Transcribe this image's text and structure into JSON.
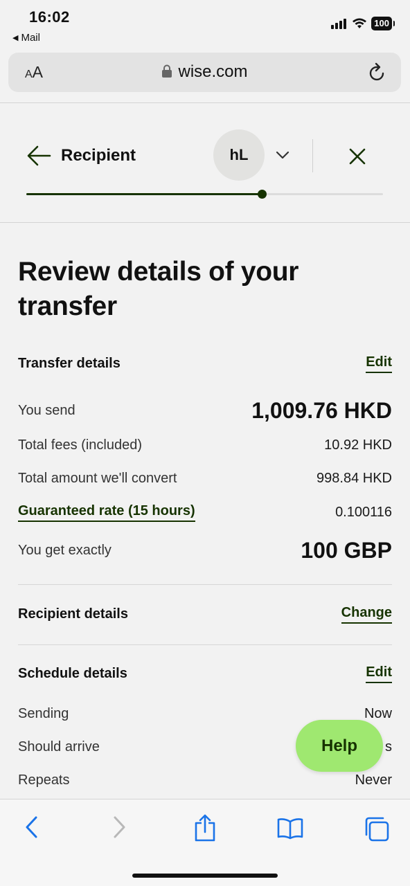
{
  "status_bar": {
    "time": "16:02",
    "back_app": "Mail",
    "battery": "100",
    "icons": [
      "signal-icon",
      "wifi-icon",
      "battery-icon"
    ]
  },
  "browser": {
    "text_size_label_small": "A",
    "text_size_label_large": "A",
    "url": "wise.com"
  },
  "header": {
    "step_title": "Recipient",
    "avatar_initials": "hL",
    "progress_fraction": 0.66
  },
  "page": {
    "title": "Review details of your transfer"
  },
  "transfer": {
    "section_label": "Transfer details",
    "edit_label": "Edit",
    "rows": [
      {
        "label": "You send",
        "value": "1,009.76 HKD"
      },
      {
        "label": "Total fees (included)",
        "value": "10.92 HKD"
      },
      {
        "label": "Total amount we'll convert",
        "value": "998.84 HKD"
      },
      {
        "label": "Guaranteed rate (15 hours)",
        "value": "0.100116"
      },
      {
        "label": "You get exactly",
        "value": "100 GBP"
      }
    ]
  },
  "recipient": {
    "section_label": "Recipient details",
    "change_label": "Change"
  },
  "schedule": {
    "section_label": "Schedule details",
    "edit_label": "Edit",
    "rows": [
      {
        "label": "Sending",
        "value": "Now"
      },
      {
        "label": "Should arrive",
        "value": "s"
      },
      {
        "label": "Repeats",
        "value": "Never"
      }
    ]
  },
  "help": {
    "label": "Help"
  },
  "colors": {
    "forest_green": "#163300",
    "bright_green": "#9fe870",
    "ios_blue": "#1a73e8"
  }
}
